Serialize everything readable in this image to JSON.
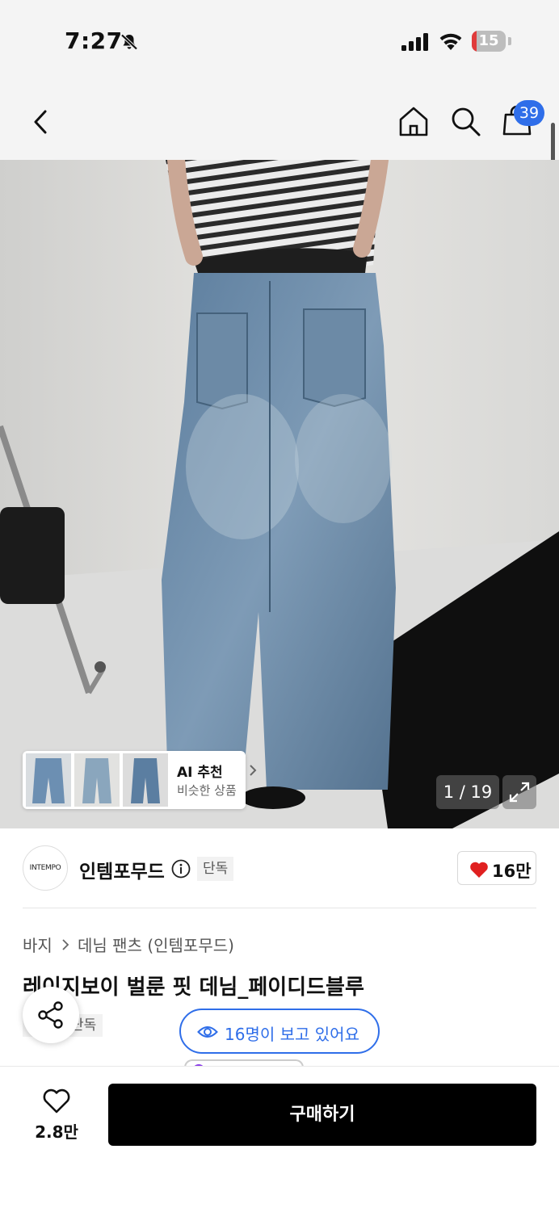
{
  "status_bar": {
    "time": "7:27",
    "battery_level": "15",
    "battery_percent": 15
  },
  "nav": {
    "cart_count": "39"
  },
  "gallery": {
    "counter": "1 / 19",
    "current_image": 1,
    "total_images": 19
  },
  "ai_recommend": {
    "title": "AI 추천",
    "subtitle": "비슷한 상품"
  },
  "brand": {
    "logo_text": "INTEMPO",
    "name": "인템포무드",
    "tag": "단독",
    "likes": "16만"
  },
  "breadcrumb": {
    "category": "바지",
    "subcategory": "데님 팬츠 (인템포무드)"
  },
  "product": {
    "title": "레이지보이 벌룬 핏 데님_페이디드블루",
    "tag": "단독"
  },
  "viewers": {
    "text": "16명이 보고 있어요"
  },
  "bottom_bar": {
    "wish_count": "2.8만",
    "buy_label": "구매하기"
  },
  "colors": {
    "accent": "#2f6ee9",
    "like_red": "#e02020",
    "buy_button": "#000000",
    "battery_low": "#e03b3b"
  },
  "icons": [
    "bell-off-icon",
    "signal-icon",
    "wifi-icon",
    "battery-icon",
    "back-icon",
    "home-icon",
    "search-icon",
    "shopping-bag-icon",
    "chevron-right-icon",
    "expand-icon",
    "info-icon",
    "heart-icon",
    "share-icon",
    "eye-icon"
  ]
}
